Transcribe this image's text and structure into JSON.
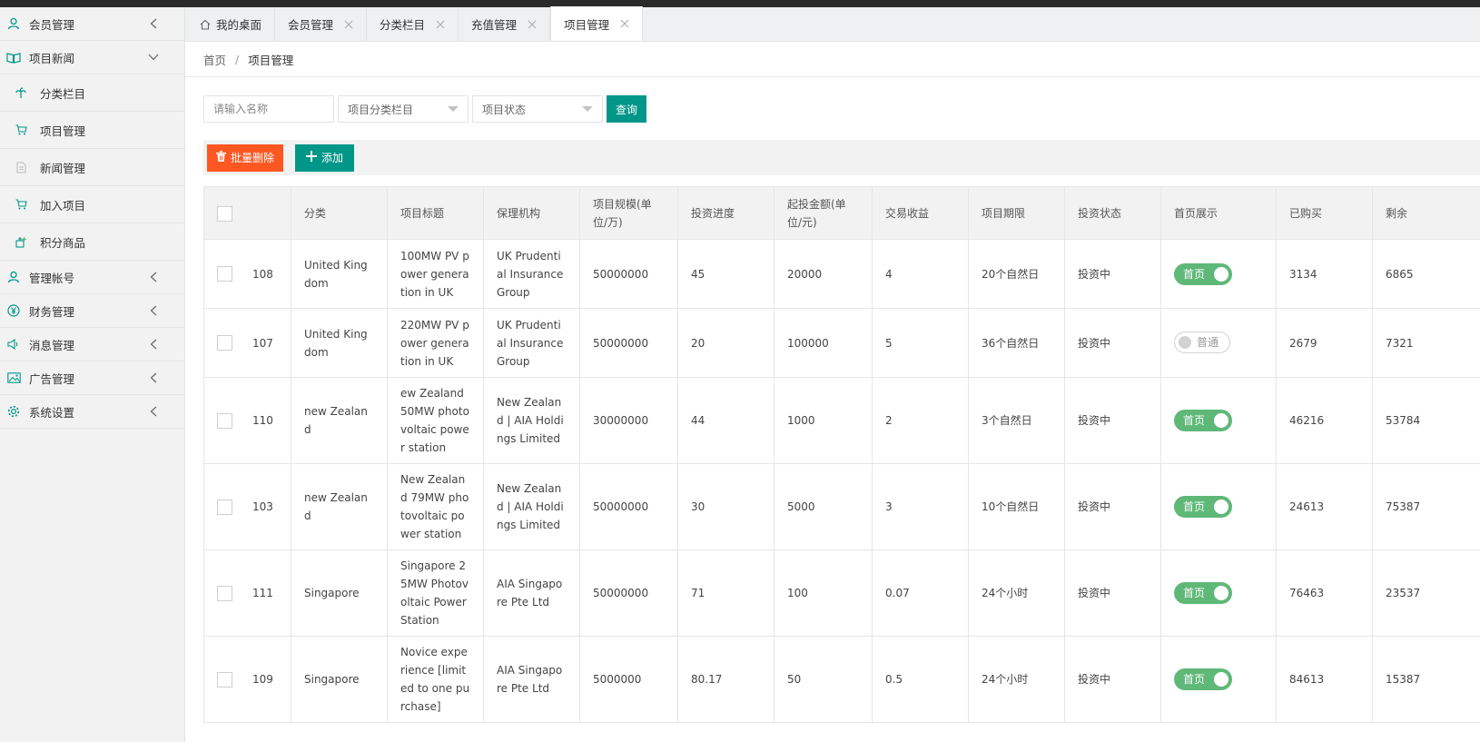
{
  "sidebar": {
    "items": [
      {
        "label": "会员管理",
        "icon": "user-icon",
        "arrow": "left"
      },
      {
        "label": "项目新闻",
        "icon": "book-icon",
        "arrow": "down"
      },
      {
        "label": "分类栏目",
        "icon": "palm-icon",
        "sub": true
      },
      {
        "label": "项目管理",
        "icon": "cart-icon",
        "sub": true
      },
      {
        "label": "新闻管理",
        "icon": "file-icon",
        "sub": true
      },
      {
        "label": "加入项目",
        "icon": "cart-icon",
        "sub": true
      },
      {
        "label": "积分商品",
        "icon": "gift-icon",
        "sub": true
      },
      {
        "label": "管理帐号",
        "icon": "user-icon",
        "arrow": "left"
      },
      {
        "label": "财务管理",
        "icon": "yen-icon",
        "arrow": "left"
      },
      {
        "label": "消息管理",
        "icon": "speaker-icon",
        "arrow": "left"
      },
      {
        "label": "广告管理",
        "icon": "picture-icon",
        "arrow": "left"
      },
      {
        "label": "系统设置",
        "icon": "gear-icon",
        "arrow": "left"
      }
    ]
  },
  "tabs": [
    {
      "label": "我的桌面",
      "home": true
    },
    {
      "label": "会员管理"
    },
    {
      "label": "分类栏目"
    },
    {
      "label": "充值管理"
    },
    {
      "label": "项目管理",
      "active": true
    }
  ],
  "breadcrumb": {
    "home": "首页",
    "separator": "/",
    "current": "项目管理"
  },
  "filters": {
    "name_placeholder": "请输入名称",
    "category_select": "项目分类栏目",
    "status_select": "项目状态",
    "query_label": "查询"
  },
  "toolbar": {
    "delete_label": "批量删除",
    "add_label": "添加"
  },
  "table": {
    "headers": [
      "",
      "分类",
      "项目标题",
      "保理机构",
      "项目规模(单位/万)",
      "投资进度",
      "起投金额(单位/元)",
      "交易收益",
      "项目期限",
      "投资状态",
      "首页展示",
      "已购买",
      "剩余"
    ],
    "rows": [
      {
        "id": "108",
        "category": "United Kingdom",
        "title": "100MW PV power generation in UK",
        "agency": "UK Prudential Insurance Group",
        "scale": "50000000",
        "progress": "45",
        "min_invest": "20000",
        "yield": "4",
        "term": "20个自然日",
        "status": "投资中",
        "home_on": true,
        "home_label": "首页",
        "bought": "3134",
        "remain": "6865"
      },
      {
        "id": "107",
        "category": "United Kingdom",
        "title": "220MW PV power generation in UK",
        "agency": "UK Prudential Insurance Group",
        "scale": "50000000",
        "progress": "20",
        "min_invest": "100000",
        "yield": "5",
        "term": "36个自然日",
        "status": "投资中",
        "home_on": false,
        "home_label": "普通",
        "bought": "2679",
        "remain": "7321"
      },
      {
        "id": "110",
        "category": "new Zealand",
        "title": "ew Zealand 50MW photovoltaic power station",
        "agency": "New Zealand | AIA Holdings Limited",
        "scale": "30000000",
        "progress": "44",
        "min_invest": "1000",
        "yield": "2",
        "term": "3个自然日",
        "status": "投资中",
        "home_on": true,
        "home_label": "首页",
        "bought": "46216",
        "remain": "53784"
      },
      {
        "id": "103",
        "category": "new Zealand",
        "title": "New Zealand 79MW photovoltaic power station",
        "agency": "New Zealand | AIA Holdings Limited",
        "scale": "50000000",
        "progress": "30",
        "min_invest": "5000",
        "yield": "3",
        "term": "10个自然日",
        "status": "投资中",
        "home_on": true,
        "home_label": "首页",
        "bought": "24613",
        "remain": "75387"
      },
      {
        "id": "111",
        "category": "Singapore",
        "title": "Singapore 25MW Photovoltaic Power Station",
        "agency": "AIA Singapore Pte Ltd",
        "scale": "50000000",
        "progress": "71",
        "min_invest": "100",
        "yield": "0.07",
        "term": "24个小时",
        "status": "投资中",
        "home_on": true,
        "home_label": "首页",
        "bought": "76463",
        "remain": "23537"
      },
      {
        "id": "109",
        "category": "Singapore",
        "title": "Novice experience [limited to one purchase]",
        "agency": "AIA Singapore Pte Ltd",
        "scale": "5000000",
        "progress": "80.17",
        "min_invest": "50",
        "yield": "0.5",
        "term": "24个小时",
        "status": "投资中",
        "home_on": true,
        "home_label": "首页",
        "bought": "84613",
        "remain": "15387"
      }
    ]
  },
  "colors": {
    "primary": "#009688",
    "danger": "#ff5722",
    "switch_on": "#5fb878"
  }
}
